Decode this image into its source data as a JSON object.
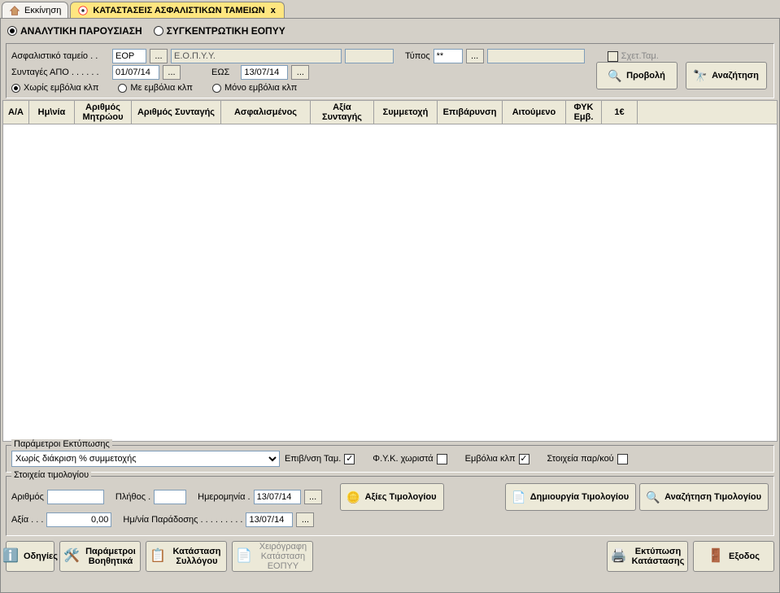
{
  "tabs": {
    "start": "Εκκίνηση",
    "active": "ΚΑΤΑΣΤΑΣΕΙΣ ΑΣΦΑΛΙΣΤΙΚΩΝ ΤΑΜΕΙΩΝ",
    "close_x": "x"
  },
  "mode": {
    "analytic": "ΑΝΑΛΥΤΙΚΗ ΠΑΡΟΥΣΙΑΣΗ",
    "summary": "ΣΥΓΚΕΝΤΡΩΤΙΚΗ ΕΟΠΥΥ"
  },
  "filters": {
    "fund_label": "Ασφαλιστικό ταμείο . .",
    "fund_code": "ΕΟΡ",
    "fund_name": "Ε.Ο.Π.Υ.Υ.",
    "type_label": "Τύπος",
    "type_code": "**",
    "related_fund": "Σχετ.Ταμ.",
    "rx_from_label": "Συνταγές ΑΠΟ . . . . . .",
    "date_from": "01/07/14",
    "rx_to_label": "ΕΩΣ",
    "date_to": "13/07/14",
    "vacc_none": "Χωρίς εμβόλια κλπ",
    "vacc_with": "Με εμβόλια κλπ",
    "vacc_only": "Μόνο εμβόλια κλπ",
    "btn_view": "Προβολή",
    "btn_search": "Αναζήτηση",
    "dots": "..."
  },
  "columns": {
    "aa": "Α/Α",
    "date": "Ημ\\νία",
    "reg_no": "Αριθμός Μητρώου",
    "rx_no": "Αριθμός Συνταγής",
    "insured": "Ασφαλισμένος",
    "rx_value": "Αξία Συνταγής",
    "participation": "Συμμετοχή",
    "surcharge": "Επιβάρυνση",
    "requested": "Αιτούμενο",
    "fyk": "ΦΥΚ Εμβ.",
    "one_euro": "1€"
  },
  "print_params": {
    "legend": "Παράμετροι Εκτύπωσης",
    "combo_value": "Χωρίς διάκριση % συμμετοχής",
    "chk_supervision": "Επιβ/νση Ταμ.",
    "chk_fyk_separate": "Φ.Υ.Κ. χωριστά",
    "chk_vaccines": "Εμβόλια κλπ",
    "chk_voucher": "Στοιχεία παρ/κού"
  },
  "invoice": {
    "legend": "Στοιχεία τιμολογίου",
    "num_label": "Αριθμός",
    "count_label": "Πλήθος .",
    "date_label": "Ημερομηνία .",
    "date_val": "13/07/14",
    "value_label": "Αξία . . .",
    "value_val": "0,00",
    "delivery_label": "Ημ/νία Παράδοσης . . . . . . . . .",
    "delivery_val": "13/07/14",
    "btn_values": "Αξίες Τιμολογίου",
    "btn_create": "Δημιουργία Τιμολογίου",
    "btn_find": "Αναζήτηση Τιμολογίου",
    "dots": "..."
  },
  "toolbar": {
    "help": "Οδηγίες",
    "aux_params": "Παράμετροι Βοηθητικά",
    "assoc_state": "Κατάσταση Συλλόγου",
    "manual_state": "Χειρόγραφη Κατάσταση ΕΟΠΥΥ",
    "print_state": "Εκτύπωση Κατάστασης",
    "exit": "Εξοδος"
  }
}
